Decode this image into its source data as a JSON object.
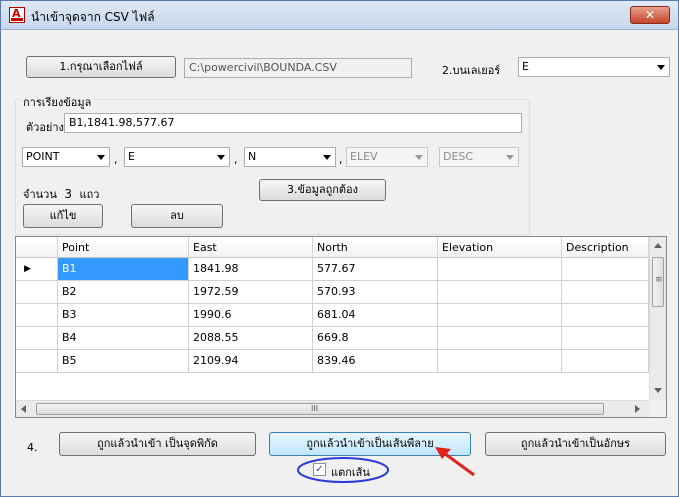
{
  "window": {
    "title": "นำเข้าจุดจาก CSV ไฟล์",
    "close_glyph": "✕"
  },
  "file": {
    "select_button": "1.กรุณาเลือกไฟล์",
    "path": "C:\\powercivil\\BOUNDA.CSV"
  },
  "layer": {
    "label": "2.บนเลเยอร์",
    "value": "E"
  },
  "group": {
    "title": "การเรียงข้อมูล",
    "sample_label": "ตัวอย่าง",
    "sample_value": "B1,1841.98,577.67"
  },
  "columns_map": [
    {
      "value": "POINT",
      "enabled": true
    },
    {
      "value": "E",
      "enabled": true
    },
    {
      "value": "N",
      "enabled": true
    },
    {
      "value": "ELEV",
      "enabled": false
    },
    {
      "value": "DESC",
      "enabled": false
    }
  ],
  "separator": ",",
  "count": {
    "label": "จำนวน",
    "value": "3",
    "unit": "แถว"
  },
  "buttons": {
    "confirm": "3.ข้อมูลถูกต้อง",
    "edit": "แก้ไข",
    "delete": "ลบ"
  },
  "grid": {
    "headers": [
      "Point",
      "East",
      "North",
      "Elevation",
      "Description"
    ],
    "rows": [
      [
        "B1",
        "1841.98",
        "577.67",
        "",
        ""
      ],
      [
        "B2",
        "1972.59",
        "570.93",
        "",
        ""
      ],
      [
        "B3",
        "1990.6",
        "681.04",
        "",
        ""
      ],
      [
        "B4",
        "2088.55",
        "669.8",
        "",
        ""
      ],
      [
        "B5",
        "2109.94",
        "839.46",
        "",
        ""
      ]
    ],
    "current_row_marker": "▶",
    "hscroll_grip": "III",
    "vscroll_grip": "≡"
  },
  "actions": {
    "step_label": "4.",
    "import_points": "ถูกแล้วนำเข้า เป็นจุดพิกัด",
    "import_polyline": "ถูกแล้วนำเข้าเป็นเส้นพืลาย",
    "import_text": "ถูกแล้วนำเข้าเป็นอักษร"
  },
  "explode": {
    "label": "แตกเส้น",
    "checked": true,
    "check_glyph": "✓"
  },
  "colors": {
    "selection": "#3399ff",
    "highlight_circle": "#2b3bd8",
    "arrow": "#e0231c",
    "title_bar": "#dfe9f6"
  }
}
